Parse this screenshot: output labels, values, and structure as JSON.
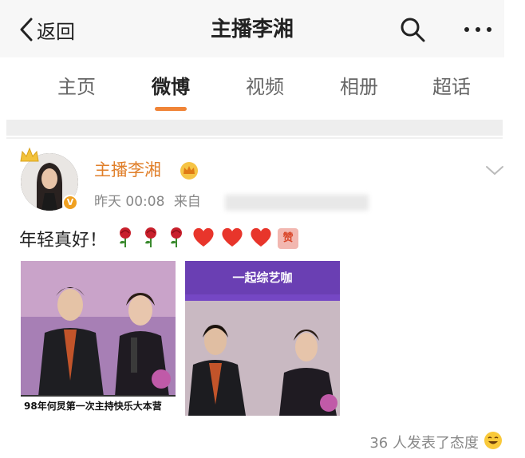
{
  "nav": {
    "back_label": "返回",
    "title": "主播李湘",
    "icons": [
      "chevron-left-icon",
      "search-icon",
      "more-icon"
    ]
  },
  "tabs": [
    {
      "label": "主页",
      "active": false
    },
    {
      "label": "微博",
      "active": true
    },
    {
      "label": "视频",
      "active": false
    },
    {
      "label": "相册",
      "active": false
    },
    {
      "label": "超话",
      "active": false
    }
  ],
  "post": {
    "author": "主播李湘",
    "time": "昨天 00:08",
    "source_prefix": "来自",
    "text": "年轻真好！",
    "emojis": [
      "rose-icon",
      "rose-icon",
      "rose-icon",
      "heart-icon",
      "heart-icon",
      "heart-icon",
      "zan-icon"
    ],
    "zan_label": "赞",
    "photos": [
      {
        "caption": "98年何炅第一次主持快乐大本营"
      },
      {
        "header": "一起综艺咖"
      }
    ],
    "reactions": "36 人发表了态度"
  },
  "colors": {
    "accent": "#f08437",
    "author": "#e07f2a",
    "muted": "#888888",
    "heart": "#e8352b"
  }
}
